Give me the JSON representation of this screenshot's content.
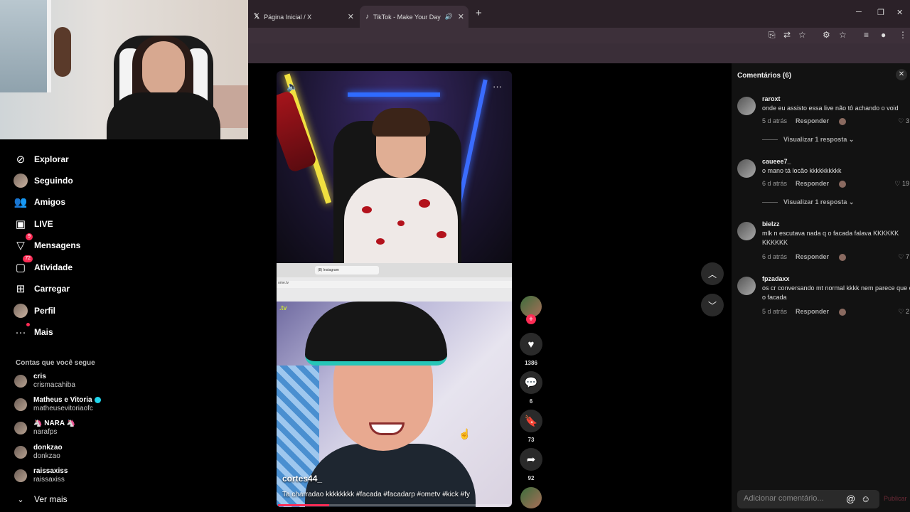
{
  "browser": {
    "tabs": [
      {
        "favicon": "x-logo-icon",
        "label": "Página Inicial / X"
      },
      {
        "favicon": "tiktok-logo-icon",
        "label": "TikTok - Make Your Day"
      }
    ]
  },
  "sidebar": {
    "items": [
      {
        "icon": "compass-icon",
        "label": "Explorar"
      },
      {
        "icon": "avatar",
        "label": "Seguindo"
      },
      {
        "icon": "friends-icon",
        "label": "Amigos"
      },
      {
        "icon": "live-icon",
        "label": "LIVE"
      },
      {
        "icon": "send-icon",
        "label": "Mensagens",
        "badge": "9"
      },
      {
        "icon": "activity-icon",
        "label": "Atividade",
        "badge": "72"
      },
      {
        "icon": "upload-icon",
        "label": "Carregar"
      },
      {
        "icon": "avatar",
        "label": "Perfil"
      },
      {
        "icon": "more-icon",
        "label": "Mais"
      }
    ],
    "following_title": "Contas que você segue",
    "following": [
      {
        "name": "cris",
        "handle": "crismacahiba"
      },
      {
        "name": "Matheus e Vitoria",
        "handle": "matheusevitoriaofc",
        "verified": true
      },
      {
        "name": "🦄 NARA 🦄",
        "handle": "narafps"
      },
      {
        "name": "donkzao",
        "handle": "donkzao"
      },
      {
        "name": "raissaxiss",
        "handle": "raissaxiss"
      }
    ],
    "see_more": "Ver mais"
  },
  "video": {
    "author": "cortes44_",
    "caption": "Ta charradao kkkkkkkk #facada #facadarp #ometv #kick #fy",
    "overlay_tab_label": "(8) Instagram",
    "overlay_url": "ome.tv",
    "overlay_tv": ".tv",
    "progress": 0.22
  },
  "actions": {
    "likes": "1386",
    "comments": "6",
    "saves": "73",
    "shares": "92"
  },
  "comments_panel": {
    "title": "Comentários (6)",
    "reply_label": "Responder",
    "view_replies": "Visualizar 1 resposta",
    "input_placeholder": "Adicionar comentário...",
    "post_label": "Publicar",
    "items": [
      {
        "user": "raroxt",
        "text": "onde eu assisto essa live não tô achando o void",
        "time": "5 d atrás",
        "likes": "3",
        "replies": true
      },
      {
        "user": "caueee7_",
        "text": "o mano tá locão kkkkkkkkkk",
        "time": "6 d atrás",
        "likes": "19",
        "replies": true
      },
      {
        "user": "bielzz",
        "text": "mlk n escutava nada q o facada falava KKKKKK KKKKKK",
        "time": "6 d atrás",
        "likes": "7",
        "replies": false
      },
      {
        "user": "fpzadaxx",
        "text": "os cr conversando mt normal kkkk nem parece que e o facada",
        "time": "5 d atrás",
        "likes": "2",
        "replies": false
      }
    ]
  },
  "colors": {
    "accent": "#fe2c55",
    "panel_bg": "#121212",
    "browser_bg": "#2b2128"
  }
}
